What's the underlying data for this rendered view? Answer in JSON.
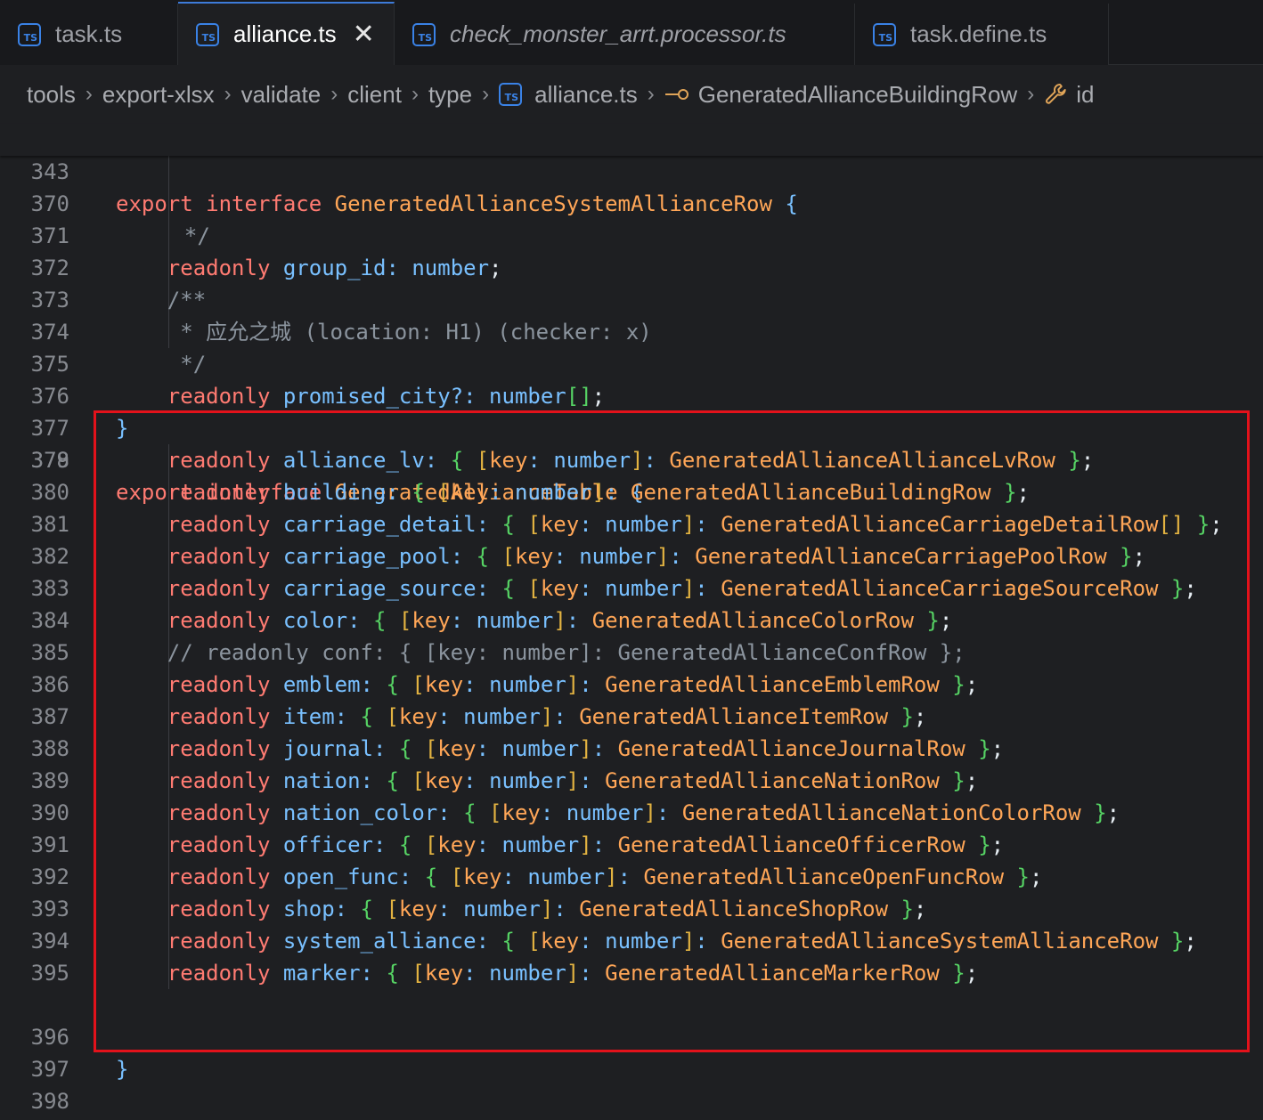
{
  "tabs": [
    {
      "label": "task.ts",
      "icon": "ts-file-icon",
      "active": false
    },
    {
      "label": "alliance.ts",
      "icon": "ts-file-icon",
      "active": true,
      "close": "✕"
    },
    {
      "label": "check_monster_arrt.processor.ts",
      "icon": "ts-file-icon",
      "active": false
    },
    {
      "label": "task.define.ts",
      "icon": "ts-file-icon",
      "active": false
    }
  ],
  "ts_badge": "TS",
  "breadcrumb": [
    "tools",
    "export-xlsx",
    "validate",
    "client",
    "type",
    "alliance.ts",
    "GeneratedAllianceBuildingRow",
    "id"
  ],
  "sticky_line": {
    "number": "343",
    "kw1": "export",
    "kw2": "interface",
    "name": "GeneratedAllianceSystemAllianceRow",
    "brace": "{"
  },
  "lines": [
    {
      "n": "370",
      "comment": "*/"
    },
    {
      "n": "371",
      "prop": "group_id",
      "type": "number"
    },
    {
      "n": "372",
      "comment": "/**"
    },
    {
      "n": "373",
      "comment": "* 应允之城 (location: H1) (checker: x)"
    },
    {
      "n": "374",
      "comment": "*/"
    },
    {
      "n": "375",
      "prop": "promised_city?",
      "type": "number",
      "array": "[]"
    },
    {
      "n": "376",
      "close": "}"
    },
    {
      "n": "377"
    },
    {
      "n": "378",
      "kw1": "export",
      "kw2": "interface",
      "name": "GeneratedAllianceTable",
      "brace": "{"
    }
  ],
  "table_rows": [
    {
      "n": "379",
      "prop": "alliance_lv",
      "row": "GeneratedAllianceAllianceLvRow"
    },
    {
      "n": "380",
      "prop": "building",
      "row": "GeneratedAllianceBuildingRow"
    },
    {
      "n": "381",
      "prop": "carriage_detail",
      "row": "GeneratedAllianceCarriageDetailRow",
      "array": "[]"
    },
    {
      "n": "382",
      "prop": "carriage_pool",
      "row": "GeneratedAllianceCarriagePoolRow"
    },
    {
      "n": "383",
      "prop": "carriage_source",
      "row": "GeneratedAllianceCarriageSourceRow"
    },
    {
      "n": "384",
      "prop": "color",
      "row": "GeneratedAllianceColorRow"
    },
    {
      "n": "385",
      "comment": "// readonly conf: { [key: number]: GeneratedAllianceConfRow };"
    },
    {
      "n": "386",
      "prop": "emblem",
      "row": "GeneratedAllianceEmblemRow"
    },
    {
      "n": "387",
      "prop": "item",
      "row": "GeneratedAllianceItemRow"
    },
    {
      "n": "388",
      "prop": "journal",
      "row": "GeneratedAllianceJournalRow"
    },
    {
      "n": "389",
      "prop": "nation",
      "row": "GeneratedAllianceNationRow"
    },
    {
      "n": "390",
      "prop": "nation_color",
      "row": "GeneratedAllianceNationColorRow"
    },
    {
      "n": "391",
      "prop": "officer",
      "row": "GeneratedAllianceOfficerRow"
    },
    {
      "n": "392",
      "prop": "open_func",
      "row": "GeneratedAllianceOpenFuncRow"
    },
    {
      "n": "393",
      "prop": "shop",
      "row": "GeneratedAllianceShopRow"
    },
    {
      "n": "394",
      "prop": "system_alliance",
      "row": "GeneratedAllianceSystemAllianceRow"
    },
    {
      "n": "395",
      "prop": "marker",
      "row": "GeneratedAllianceMarkerRow"
    }
  ],
  "tail": [
    {
      "n": "396",
      "close": "}"
    },
    {
      "n": "397"
    },
    {
      "n": "398"
    }
  ],
  "tokens": {
    "readonly": "readonly",
    "key": "key",
    "number": "number"
  },
  "colors": {
    "highlight_border": "#e3121b",
    "tab_active_accent": "#3d7bd9"
  }
}
